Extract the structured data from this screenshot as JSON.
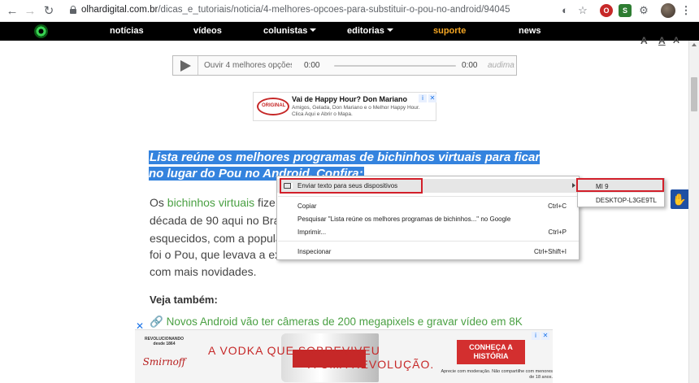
{
  "browser": {
    "back_icon": "arrow-left-icon",
    "forward_icon": "arrow-right-icon",
    "reload_icon": "reload-icon",
    "url_domain": "olhardigital.com.br",
    "url_path": "/dicas_e_tutoriais/noticia/4-melhores-opcoes-para-substituir-o-pou-no-android/94045",
    "toolbar_icons": [
      "translate-icon",
      "star-icon",
      "opera-extension-icon",
      "s-extension-icon",
      "puzzle-extension-icon",
      "avatar",
      "more-vert-icon"
    ]
  },
  "sitenav": {
    "items": [
      "notícias",
      "vídeos",
      "colunistas",
      "editorias",
      "suporte",
      "news"
    ]
  },
  "font_controls": [
    "A",
    "A",
    "A"
  ],
  "audio": {
    "title": "Ouvir 4 melhores opções pa",
    "time_current": "0:00",
    "time_total": "0:00",
    "brand": "audima"
  },
  "small_ad": {
    "logo_text": "ORIGINAL",
    "title": "Vai de Happy Hour? Don Mariano",
    "body": "Amigos, Gelada, Don Mariano e o Melhor Happy Hour. Clica Aqui e Abrir o Mapa."
  },
  "article": {
    "headline": "Lista reúne os melhores programas de bichinhos virtuais para ficar no lugar do Pou no Android. Confira:",
    "para_lines": [
      {
        "pre": "Os ",
        "link": "bichinhos virtuais",
        "post": " fize"
      },
      {
        "pre": "década de 90 aqui no Bra",
        "link": "",
        "post": ""
      },
      {
        "pre": "esquecidos, com a popula",
        "link": "",
        "post": ""
      },
      {
        "pre": "foi o Pou, que levava a ex",
        "link": "",
        "post": ""
      },
      {
        "pre": "com mais novidades.",
        "link": "",
        "post": ""
      }
    ],
    "veja_label": "Veja também:",
    "related_link": "Novos Android vão ter câmeras de 200 megapixels e gravar vídeo em 8K"
  },
  "context_menu": {
    "items": [
      {
        "label": "Enviar texto para seus dispositivos",
        "shortcut": "",
        "has_submenu": true
      },
      {
        "label": "Copiar",
        "shortcut": "Ctrl+C",
        "has_submenu": false
      },
      {
        "label": "Pesquisar \"Lista reúne os melhores programas de bichinhos...\" no Google",
        "shortcut": "",
        "has_submenu": false
      },
      {
        "label": "Imprimir...",
        "shortcut": "Ctrl+P",
        "has_submenu": false
      },
      {
        "label": "Inspecionar",
        "shortcut": "Ctrl+Shift+I",
        "has_submenu": false
      }
    ]
  },
  "submenu": {
    "devices": [
      "MI 9",
      "DESKTOP-L3GE9TL"
    ]
  },
  "bottom_ad": {
    "logo_line": "REVOLUCIONANDO desde 1864",
    "logo_brand": "Smirnoff",
    "line1": "A VODKA QUE SOBREVIVEU",
    "line2": "À UMA REVOLUÇÃO.",
    "cta": "CONHEÇA A HISTÓRIA",
    "fine_print": "Aprecie com moderação. Não compartilhe com menores de 18 anos."
  },
  "colors": {
    "selection": "#3483de",
    "link_green": "#4aa043",
    "highlight_red": "#d21f2a",
    "nav_bg": "#000000",
    "nav_accent": "#f5a623"
  }
}
